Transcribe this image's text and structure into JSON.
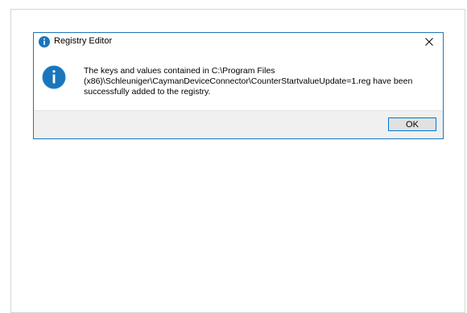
{
  "dialog": {
    "title": "Registry Editor",
    "close_glyph": "✕",
    "title_icon": "info-icon",
    "message_icon": "info-icon",
    "message_line1": "The keys and values contained in C:\\Program Files",
    "message_line2": "(x86)\\Schleuniger\\CaymanDeviceConnector\\CounterStartvalueUpdate=1.reg have been",
    "message_line3": "successfully added to the registry.",
    "ok_label": "OK"
  },
  "colors": {
    "accent": "#1b75bb",
    "footer_bg": "#f0f0f0",
    "button_border": "#0078d7"
  }
}
